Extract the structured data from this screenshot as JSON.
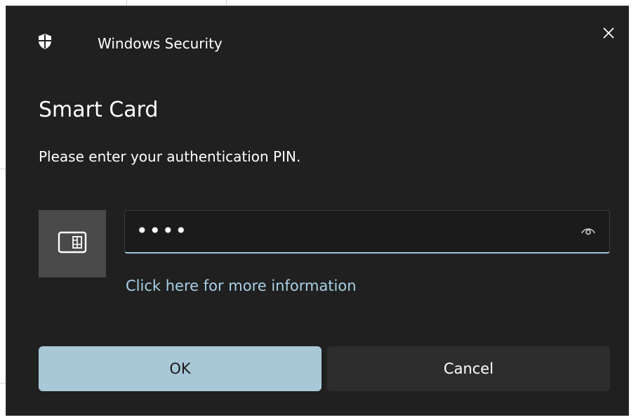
{
  "window": {
    "app_title": "Windows Security",
    "close_icon": "close-icon",
    "shield_icon": "shield-icon"
  },
  "dialog": {
    "heading": "Smart Card",
    "prompt": "Please enter your authentication PIN."
  },
  "pin_field": {
    "value": "••••",
    "masked": true,
    "reveal_icon": "eye-icon"
  },
  "card_tile": {
    "icon": "smart-card-icon"
  },
  "links": {
    "more_info": "Click here for more information"
  },
  "buttons": {
    "ok_label": "OK",
    "cancel_label": "Cancel"
  },
  "colors": {
    "dialog_bg": "#202020",
    "accent": "#a8c8d8",
    "link": "#a8d0e6",
    "secondary_button": "#2d2d2d"
  }
}
